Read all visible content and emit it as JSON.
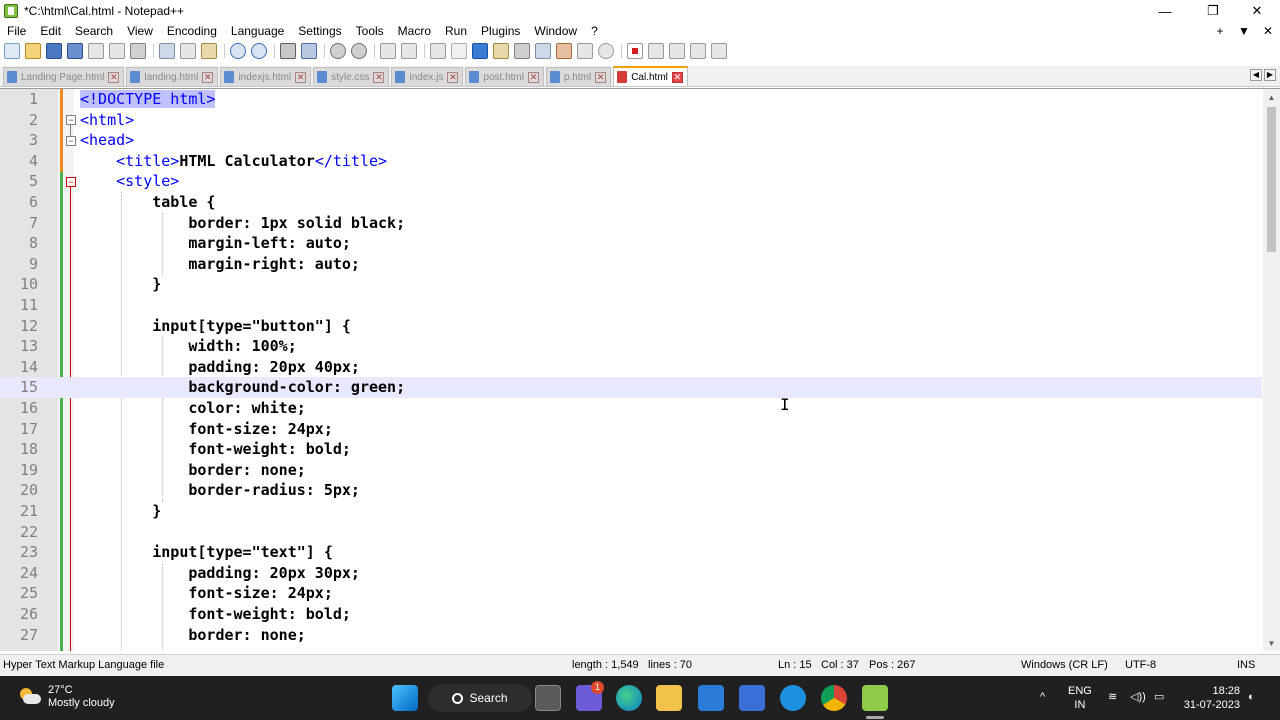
{
  "window": {
    "title": "*C:\\html\\Cal.html - Notepad++",
    "minimize_glyph": "—",
    "maximize_glyph": "❐",
    "close_glyph": "✕"
  },
  "menu": {
    "items": [
      "File",
      "Edit",
      "Search",
      "View",
      "Encoding",
      "Language",
      "Settings",
      "Tools",
      "Macro",
      "Run",
      "Plugins",
      "Window",
      "?"
    ],
    "right_plus": "+",
    "right_down": "▼",
    "right_close": "✕"
  },
  "tabs": [
    {
      "label": "Landing Page.html",
      "active": false
    },
    {
      "label": "landing.html",
      "active": false
    },
    {
      "label": "indexjs.html",
      "active": false
    },
    {
      "label": "style.css",
      "active": false
    },
    {
      "label": "index.js",
      "active": false
    },
    {
      "label": "post.html",
      "active": false
    },
    {
      "label": "p.html",
      "active": false
    },
    {
      "label": "Cal.html",
      "active": true
    }
  ],
  "tab_close_glyph": "✕",
  "tab_nav": {
    "left": "◀",
    "right": "▶"
  },
  "editor": {
    "current_line": 15,
    "lines": [
      {
        "n": "1",
        "text": "<!DOCTYPE html>"
      },
      {
        "n": "2",
        "text": "<html>"
      },
      {
        "n": "3",
        "text": "<head>"
      },
      {
        "n": "4",
        "text": "    <title>HTML Calculator</title>"
      },
      {
        "n": "5",
        "text": "    <style>"
      },
      {
        "n": "6",
        "text": "        table {"
      },
      {
        "n": "7",
        "text": "            border: 1px solid black;"
      },
      {
        "n": "8",
        "text": "            margin-left: auto;"
      },
      {
        "n": "9",
        "text": "            margin-right: auto;"
      },
      {
        "n": "10",
        "text": "        }"
      },
      {
        "n": "11",
        "text": ""
      },
      {
        "n": "12",
        "text": "        input[type=\"button\"] {"
      },
      {
        "n": "13",
        "text": "            width: 100%;"
      },
      {
        "n": "14",
        "text": "            padding: 20px 40px;"
      },
      {
        "n": "15",
        "text": "            background-color: green;"
      },
      {
        "n": "16",
        "text": "            color: white;"
      },
      {
        "n": "17",
        "text": "            font-size: 24px;"
      },
      {
        "n": "18",
        "text": "            font-weight: bold;"
      },
      {
        "n": "19",
        "text": "            border: none;"
      },
      {
        "n": "20",
        "text": "            border-radius: 5px;"
      },
      {
        "n": "21",
        "text": "        }"
      },
      {
        "n": "22",
        "text": ""
      },
      {
        "n": "23",
        "text": "        input[type=\"text\"] {"
      },
      {
        "n": "24",
        "text": "            padding: 20px 30px;"
      },
      {
        "n": "25",
        "text": "            font-size: 24px;"
      },
      {
        "n": "26",
        "text": "            font-weight: bold;"
      },
      {
        "n": "27",
        "text": "            border: none;"
      }
    ]
  },
  "statusbar": {
    "file_type": "Hyper Text Markup Language file",
    "length": "length : 1,549",
    "lines": "lines : 70",
    "ln": "Ln : 15",
    "col": "Col : 37",
    "pos": "Pos : 267",
    "eol": "Windows (CR LF)",
    "encoding": "UTF-8",
    "mode": "INS"
  },
  "taskbar": {
    "temperature": "27°C",
    "weather": "Mostly cloudy",
    "search_label": "Search",
    "notification_badge": "1",
    "lang_top": "ENG",
    "lang_bottom": "IN",
    "time": "18:28",
    "date": "31-07-2023",
    "chevron": "^"
  }
}
